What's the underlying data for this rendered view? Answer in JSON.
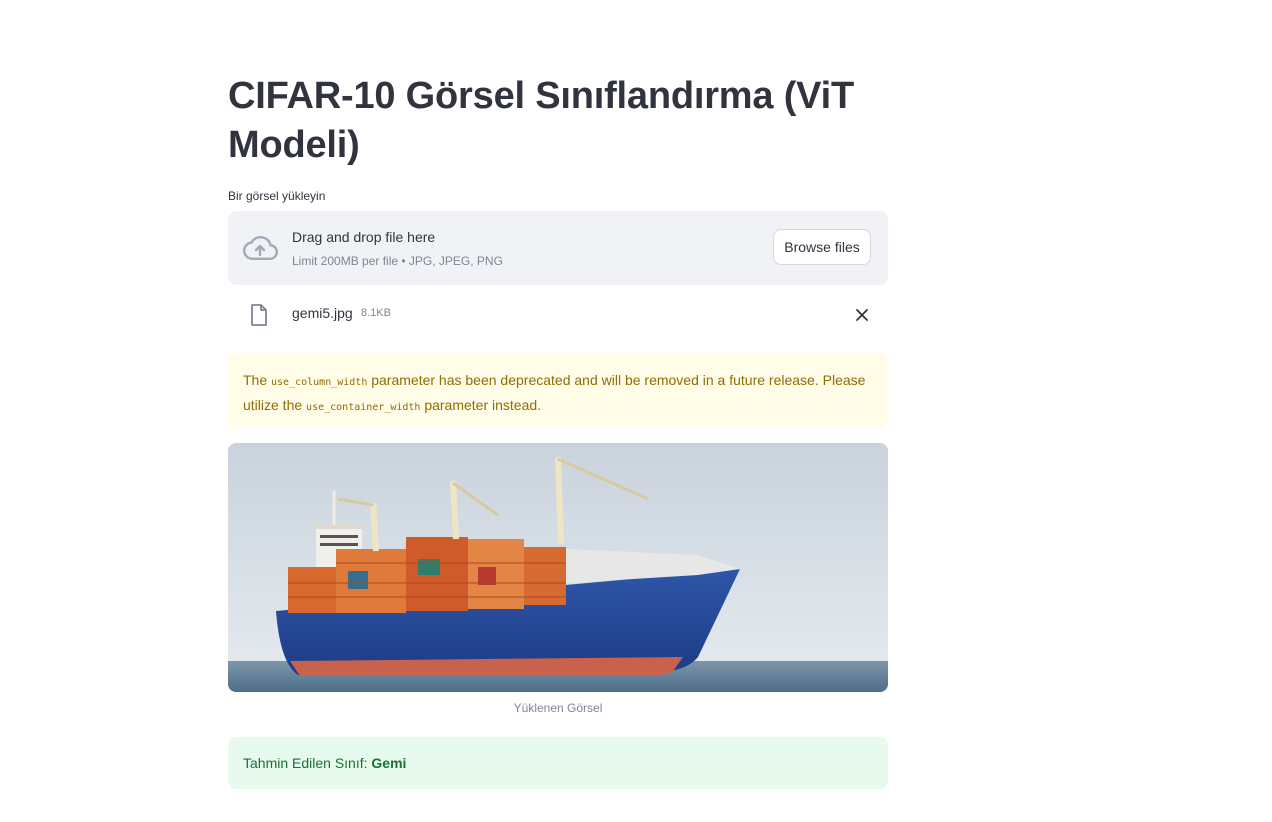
{
  "page": {
    "title": "CIFAR-10 Görsel Sınıflandırma (ViT Modeli)"
  },
  "uploader": {
    "label": "Bir görsel yükleyin",
    "dropzone_title": "Drag and drop file here",
    "dropzone_limit": "Limit 200MB per file • JPG, JPEG, PNG",
    "browse_label": "Browse files",
    "file": {
      "name": "gemi5.jpg",
      "size": "8.1KB"
    }
  },
  "warning": {
    "part1": "The ",
    "code1": "use_column_width",
    "part2": " parameter has been deprecated and will be removed in a future release. Please utilize the ",
    "code2": "use_container_width",
    "part3": " parameter instead."
  },
  "image": {
    "caption": "Yüklenen Görsel"
  },
  "result": {
    "label": "Tahmin Edilen Sınıf: ",
    "value": "Gemi"
  },
  "colors": {
    "warning_bg": "#fffce7",
    "warning_text": "#926c05",
    "success_bg": "#e8f9ee",
    "success_text": "#177233",
    "dropzone_bg": "#f0f2f6"
  }
}
